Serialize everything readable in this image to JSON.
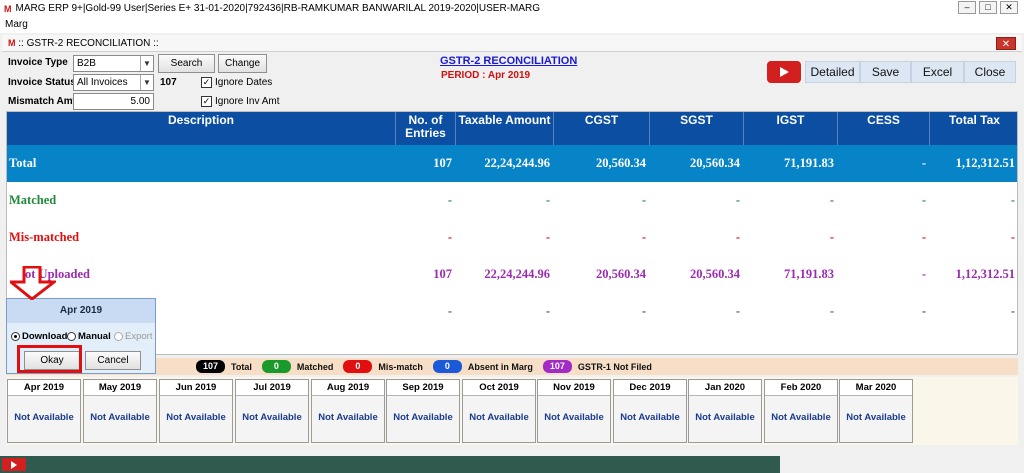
{
  "app": {
    "title": "MARG ERP 9+|Gold-99 User|Series E+ 31-01-2020|792436|RB-RAMKUMAR BANWARILAL 2019-2020|USER-MARG",
    "logo": "M",
    "menu": "Marg",
    "window_controls": [
      "–",
      "□",
      "✕"
    ]
  },
  "window": {
    "title": ":: GSTR-2 RECONCILIATION ::",
    "close": "✕"
  },
  "filters": {
    "invoice_type_label": "Invoice Type",
    "invoice_type_value": "B2B",
    "search_label": "Search",
    "change_label": "Change",
    "invoice_status_label": "Invoice Status",
    "invoice_status_value": "All Invoices",
    "count": "107",
    "ignore_dates_label": "Ignore Dates",
    "ignore_inv_amt_label": "Ignore Inv Amt",
    "mismatch_label": "Mismatch Amt",
    "mismatch_value": "5.00"
  },
  "report": {
    "title": "GSTR-2 RECONCILIATION",
    "period": "PERIOD : Apr 2019"
  },
  "actions": {
    "detailed": "Detailed",
    "save": "Save",
    "excel": "Excel",
    "close": "Close"
  },
  "grid": {
    "headers": [
      "Description",
      "No. of Entries",
      "Taxable Amount",
      "CGST",
      "SGST",
      "IGST",
      "CESS",
      "Total Tax"
    ],
    "rows": [
      {
        "desc": "Total",
        "cells": [
          "107",
          "22,24,244.96",
          "20,560.34",
          "20,560.34",
          "71,191.83",
          "-",
          "1,12,312.51"
        ],
        "color": "#ffffff"
      },
      {
        "desc": "Matched",
        "cells": [
          "-",
          "-",
          "-",
          "-",
          "-",
          "-",
          "-"
        ],
        "color": "#1f8a3a"
      },
      {
        "desc": "Mis-matched",
        "cells": [
          "-",
          "-",
          "-",
          "-",
          "-",
          "-",
          "-"
        ],
        "color": "#e01010"
      },
      {
        "desc": "ot Uploaded",
        "cells": [
          "107",
          "22,24,244.96",
          "20,560.34",
          "20,560.34",
          "71,191.83",
          "-",
          "1,12,312.51"
        ],
        "color": "#9b2bb0"
      },
      {
        "desc": "",
        "cells": [
          "-",
          "-",
          "-",
          "-",
          "-",
          "-",
          "-"
        ],
        "color": "#555555"
      }
    ]
  },
  "legend": [
    {
      "count": "107",
      "label": "Total",
      "color": "#000000"
    },
    {
      "count": "0",
      "label": "Matched",
      "color": "#1a9a2a"
    },
    {
      "count": "0",
      "label": "Mis-match",
      "color": "#e01010"
    },
    {
      "count": "0",
      "label": "Absent in Marg",
      "color": "#1a5ad8"
    },
    {
      "count": "107",
      "label": "GSTR-1 Not Filed",
      "color": "#a12bc4"
    }
  ],
  "months": [
    {
      "name": "Apr 2019",
      "status": "Not Available"
    },
    {
      "name": "May 2019",
      "status": "Not Available"
    },
    {
      "name": "Jun 2019",
      "status": "Not Available"
    },
    {
      "name": "Jul 2019",
      "status": "Not Available"
    },
    {
      "name": "Aug 2019",
      "status": "Not Available"
    },
    {
      "name": "Sep 2019",
      "status": "Not Available"
    },
    {
      "name": "Oct 2019",
      "status": "Not Available"
    },
    {
      "name": "Nov 2019",
      "status": "Not Available"
    },
    {
      "name": "Dec 2019",
      "status": "Not Available"
    },
    {
      "name": "Jan 2020",
      "status": "Not Available"
    },
    {
      "name": "Feb 2020",
      "status": "Not Available"
    },
    {
      "name": "Mar 2020",
      "status": "Not Available"
    }
  ],
  "popup": {
    "title": "Apr 2019",
    "download": "Download",
    "manual": "Manual",
    "export": "Export",
    "okay": "Okay",
    "cancel": "Cancel"
  }
}
